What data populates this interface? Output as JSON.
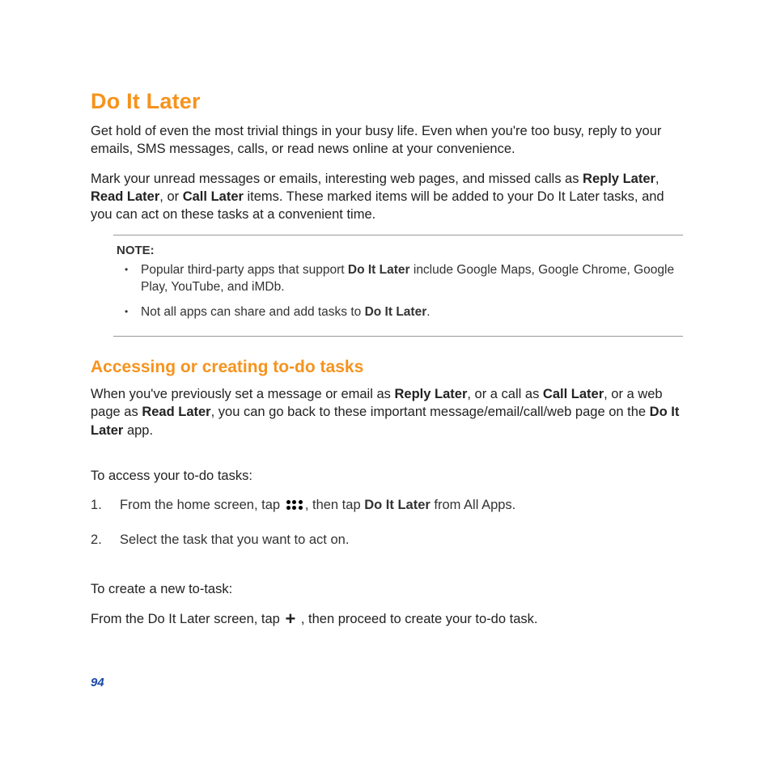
{
  "page_number": "94",
  "section": {
    "title": "Do It Later",
    "intro1": "Get hold of even the most trivial things in your busy life. Even when you're too busy,  reply to your emails, SMS messages, calls, or read news online at your convenience.",
    "intro2_pre": "Mark your unread messages or emails, interesting web pages, and missed calls as ",
    "intro2_b1": "Reply Later",
    "intro2_mid1": ", ",
    "intro2_b2": "Read Later",
    "intro2_mid2": ", or ",
    "intro2_b3": "Call Later",
    "intro2_post": " items. These marked items will be added to your Do It Later tasks, and you can act on these tasks at a convenient time."
  },
  "note": {
    "label": "NOTE:",
    "item1_pre": "Popular third-party apps that support ",
    "item1_b": "Do It Later",
    "item1_post": " include Google Maps, Google Chrome, Google Play, YouTube, and iMDb.",
    "item2_pre": "Not all apps can share and add tasks to ",
    "item2_b": "Do It Later",
    "item2_post": "."
  },
  "subsection": {
    "title": "Accessing or creating to-do tasks",
    "para_pre": "When you've previously set a message or email as ",
    "para_b1": "Reply Later",
    "para_mid1": ", or a call as ",
    "para_b2": "Call Later",
    "para_mid2": ", or a web page as ",
    "para_b3": "Read Later",
    "para_mid3": ", you can go back to these important message/email/call/web page on the ",
    "para_b4": "Do It Later",
    "para_post": " app."
  },
  "access": {
    "lead": "To access your to-do tasks:",
    "step1_pre": "From the home screen, tap ",
    "step1_mid": ", then tap ",
    "step1_b": "Do It Later",
    "step1_post": " from All Apps.",
    "step2": "Select the task that you want to act on."
  },
  "create": {
    "lead": "To create a new to-task:",
    "line_pre": "From the Do It Later screen, tap ",
    "line_post": " , then proceed to create your to-do task."
  },
  "icons": {
    "apps": "all-apps-icon",
    "plus": "+"
  }
}
